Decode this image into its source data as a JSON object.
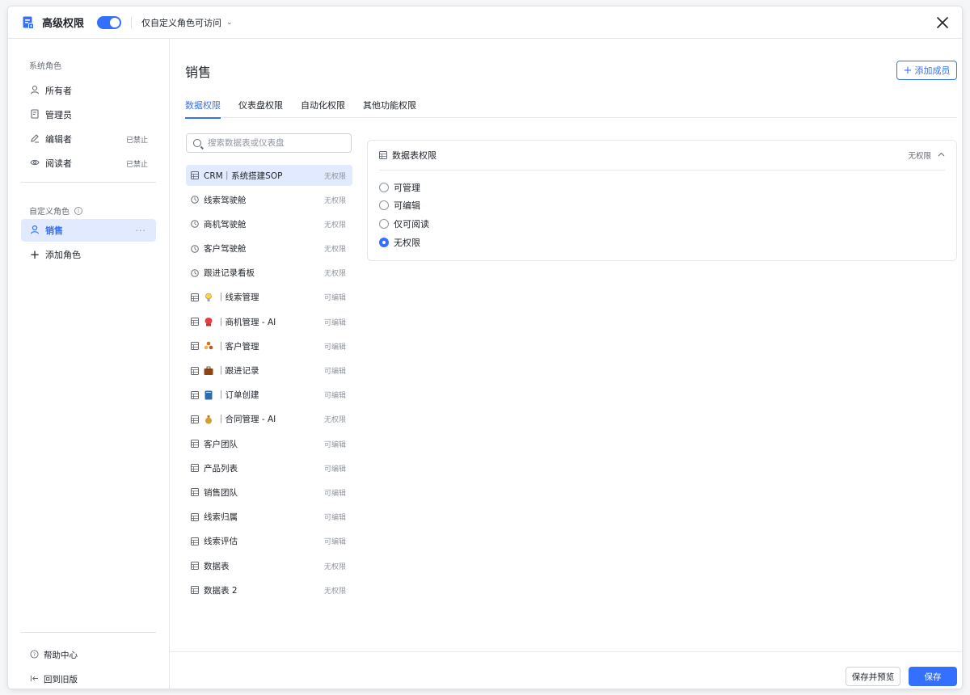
{
  "header": {
    "title": "高级权限",
    "toggle_on": true,
    "access_select": "仅自定义角色可访问"
  },
  "sidebar": {
    "system_group_title": "系统角色",
    "system_roles": [
      {
        "label": "所有者",
        "icon": "user-icon",
        "tag": ""
      },
      {
        "label": "管理员",
        "icon": "admin-doc-icon",
        "tag": ""
      },
      {
        "label": "编辑者",
        "icon": "pencil-icon",
        "tag": "已禁止"
      },
      {
        "label": "阅读者",
        "icon": "eye-icon",
        "tag": "已禁止"
      }
    ],
    "custom_group_title": "自定义角色",
    "custom_roles": [
      {
        "label": "销售",
        "icon": "user-icon",
        "active": true
      }
    ],
    "add_role_label": "添加角色",
    "help_label": "帮助中心",
    "back_label": "回到旧版"
  },
  "main": {
    "page_title": "销售",
    "add_member_label": "添加成员",
    "tabs": [
      {
        "label": "数据权限",
        "active": true
      },
      {
        "label": "仪表盘权限",
        "active": false
      },
      {
        "label": "自动化权限",
        "active": false
      },
      {
        "label": "其他功能权限",
        "active": false
      }
    ],
    "search_placeholder": "搜索数据表或仪表盘",
    "tables": [
      {
        "kind": "table",
        "emoji": "",
        "name": "CRM｜系统搭建SOP",
        "perm": "无权限",
        "selected": true
      },
      {
        "kind": "dashboard",
        "emoji": "",
        "name": "线索驾驶舱",
        "perm": "无权限"
      },
      {
        "kind": "dashboard",
        "emoji": "",
        "name": "商机驾驶舱",
        "perm": "无权限"
      },
      {
        "kind": "dashboard",
        "emoji": "",
        "name": "客户驾驶舱",
        "perm": "无权限"
      },
      {
        "kind": "dashboard",
        "emoji": "",
        "name": "跟进记录看板",
        "perm": "无权限"
      },
      {
        "kind": "table",
        "emoji": "bulb",
        "name": "｜线索管理",
        "perm": "可编辑"
      },
      {
        "kind": "table",
        "emoji": "glove",
        "name": "｜商机管理 - AI",
        "perm": "可编辑"
      },
      {
        "kind": "table",
        "emoji": "people",
        "name": "｜客户管理",
        "perm": "可编辑"
      },
      {
        "kind": "table",
        "emoji": "briefcase",
        "name": "｜跟进记录",
        "perm": "可编辑"
      },
      {
        "kind": "table",
        "emoji": "book",
        "name": "｜订单创建",
        "perm": "可编辑"
      },
      {
        "kind": "table",
        "emoji": "moneybag",
        "name": "｜合同管理 - AI",
        "perm": "无权限"
      },
      {
        "kind": "table",
        "emoji": "",
        "name": "客户团队",
        "perm": "可编辑"
      },
      {
        "kind": "table",
        "emoji": "",
        "name": "产品列表",
        "perm": "可编辑"
      },
      {
        "kind": "table",
        "emoji": "",
        "name": "销售团队",
        "perm": "可编辑"
      },
      {
        "kind": "table",
        "emoji": "",
        "name": "线索归属",
        "perm": "可编辑"
      },
      {
        "kind": "table",
        "emoji": "",
        "name": "线索评估",
        "perm": "可编辑"
      },
      {
        "kind": "table",
        "emoji": "",
        "name": "数据表",
        "perm": "无权限"
      },
      {
        "kind": "table",
        "emoji": "",
        "name": "数据表 2",
        "perm": "无权限"
      }
    ],
    "panel": {
      "title": "数据表权限",
      "value": "无权限",
      "options": [
        {
          "label": "可管理",
          "checked": false
        },
        {
          "label": "可编辑",
          "checked": false
        },
        {
          "label": "仅可阅读",
          "checked": false
        },
        {
          "label": "无权限",
          "checked": true
        }
      ]
    }
  },
  "footer": {
    "save_preview_label": "保存并预览",
    "save_label": "保存"
  },
  "colors": {
    "accent": "#3370ff",
    "accent_bg": "#e1eaff"
  }
}
